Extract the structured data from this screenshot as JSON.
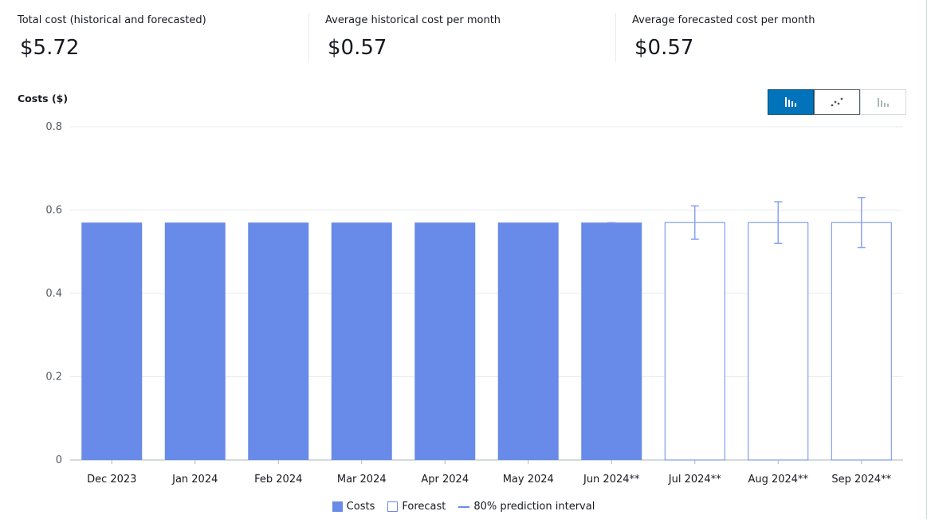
{
  "summary": {
    "total": {
      "label": "Total cost (historical and forecasted)",
      "value": "$5.72"
    },
    "avg_hist": {
      "label": "Average historical cost per month",
      "value": "$0.57"
    },
    "avg_fcst": {
      "label": "Average forecasted cost per month",
      "value": "$0.57"
    }
  },
  "chart_toggle": [
    "bar-chart-icon",
    "line-chart-icon",
    "stacked-bar-chart-icon"
  ],
  "chart_data": {
    "type": "bar",
    "ylabel": "Costs ($)",
    "ylim": [
      0,
      0.8
    ],
    "yticks": [
      "0",
      "0.2",
      "0.4",
      "0.6",
      "0.8"
    ],
    "grid": true,
    "categories": [
      "Dec 2023",
      "Jan 2024",
      "Feb 2024",
      "Mar 2024",
      "Apr 2024",
      "May 2024",
      "Jun 2024**",
      "Jul 2024**",
      "Aug 2024**",
      "Sep 2024**"
    ],
    "series": [
      {
        "name": "Costs",
        "values": [
          0.57,
          0.57,
          0.57,
          0.57,
          0.57,
          0.57,
          0.57,
          null,
          null,
          null
        ]
      },
      {
        "name": "Forecast",
        "values": [
          null,
          null,
          null,
          null,
          null,
          null,
          null,
          0.57,
          0.57,
          0.57
        ]
      }
    ],
    "prediction_interval": {
      "name": "80% prediction interval",
      "low": [
        null,
        null,
        null,
        null,
        null,
        null,
        0.57,
        0.53,
        0.52,
        0.51
      ],
      "high": [
        null,
        null,
        null,
        null,
        null,
        null,
        0.57,
        0.61,
        0.62,
        0.63
      ]
    },
    "legend": [
      "Costs",
      "Forecast",
      "80% prediction interval"
    ],
    "legend_position": "bottom-center",
    "colors": {
      "costs": "#688ae8",
      "forecast_border": "#688ae8",
      "grid": "#e9ebed"
    }
  }
}
